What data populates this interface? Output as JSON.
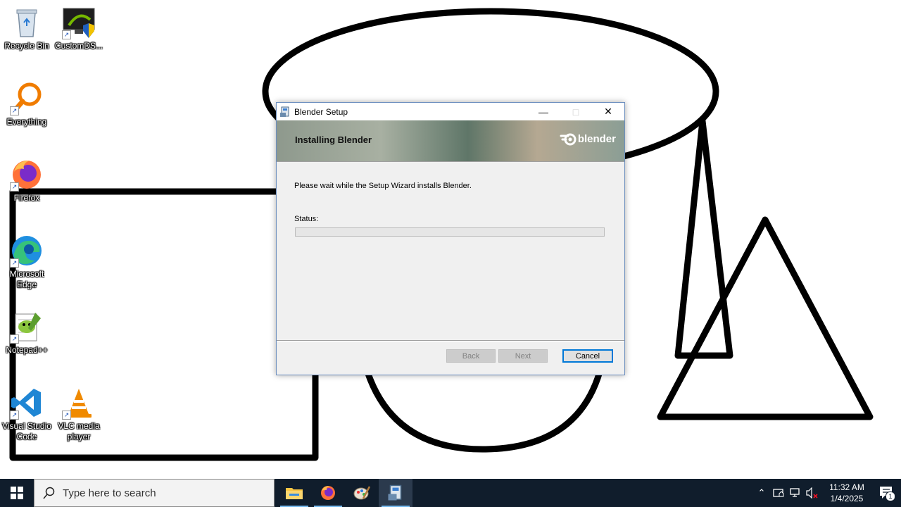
{
  "desktop": {
    "icons": [
      {
        "label": "Recycle Bin",
        "icon": "recycle-bin-icon"
      },
      {
        "label": "CustomDS...",
        "icon": "customds-icon"
      },
      {
        "label": "Everything",
        "icon": "everything-search-icon"
      },
      {
        "label": "Firefox",
        "icon": "firefox-icon"
      },
      {
        "label": "Microsoft Edge",
        "icon": "edge-icon"
      },
      {
        "label": "Notepad++",
        "icon": "notepadpp-icon"
      },
      {
        "label": "Visual Studio Code",
        "icon": "vscode-icon"
      },
      {
        "label": "VLC media player",
        "icon": "vlc-icon"
      }
    ]
  },
  "dialog": {
    "title": "Blender Setup",
    "heading": "Installing Blender",
    "logo_text": "blender",
    "wait_text": "Please wait while the Setup Wizard installs Blender.",
    "status_label": "Status:",
    "progress": 0,
    "buttons": {
      "back": "Back",
      "next": "Next",
      "cancel": "Cancel"
    }
  },
  "taskbar": {
    "search_placeholder": "Type here to search",
    "apps": [
      "file-explorer-icon",
      "firefox-icon",
      "paint-icon",
      "installer-icon"
    ],
    "clock_time": "11:32 AM",
    "clock_date": "1/4/2025",
    "notification_count": "1"
  },
  "colors": {
    "taskbar_bg": "#101d2c",
    "accent": "#0078d7"
  }
}
